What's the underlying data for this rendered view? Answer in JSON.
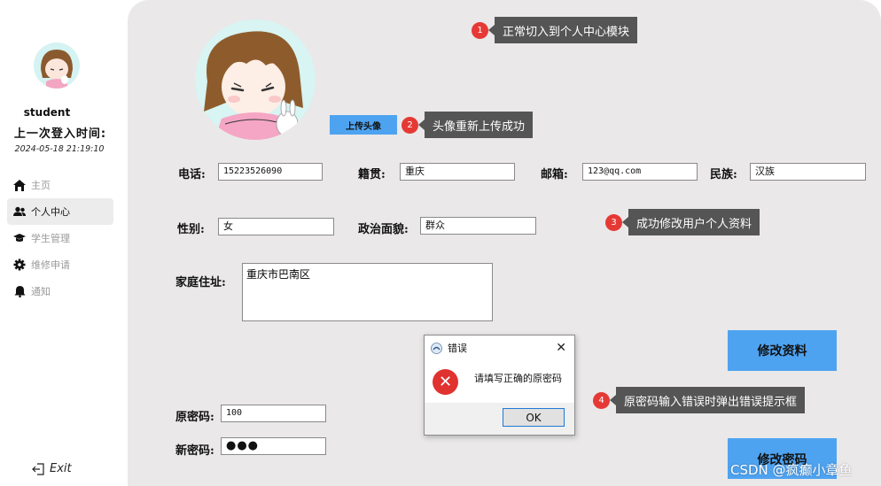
{
  "sidebar": {
    "username": "student",
    "last_login_label": "上一次登入时间:",
    "last_login_time": "2024-05-18 21:19:10",
    "items": [
      {
        "label": "主页",
        "icon": "home-icon"
      },
      {
        "label": "个人中心",
        "icon": "users-icon"
      },
      {
        "label": "学生管理",
        "icon": "graduation-cap-icon"
      },
      {
        "label": "维修申请",
        "icon": "gear-icon"
      },
      {
        "label": "通知",
        "icon": "bell-icon"
      }
    ],
    "active_item": "个人中心",
    "exit_label": "Exit"
  },
  "profile": {
    "upload_label": "上传头像",
    "fields": {
      "phone": {
        "label": "电话:",
        "value": "15223526090"
      },
      "native_place": {
        "label": "籍贯:",
        "value": "重庆"
      },
      "email": {
        "label": "邮箱:",
        "value": "123@qq.com"
      },
      "ethnicity": {
        "label": "民族:",
        "value": "汉族"
      },
      "gender": {
        "label": "性别:",
        "value": "女"
      },
      "political": {
        "label": "政治面貌:",
        "value": "群众"
      },
      "address": {
        "label": "家庭住址:",
        "value": "重庆市巴南区"
      },
      "old_password": {
        "label": "原密码:",
        "value": "100"
      },
      "new_password": {
        "label": "新密码:",
        "value": "●●●"
      }
    },
    "modify_info_label": "修改资料",
    "modify_password_label": "修改密码"
  },
  "callouts": [
    {
      "num": "1",
      "text": "正常切入到个人中心模块"
    },
    {
      "num": "2",
      "text": "头像重新上传成功"
    },
    {
      "num": "3",
      "text": "成功修改用户个人资料"
    },
    {
      "num": "4",
      "text": "原密码输入错误时弹出错误提示框"
    }
  ],
  "dialog": {
    "title": "错误",
    "message": "请填写正确的原密码",
    "ok_label": "OK"
  },
  "watermark": "CSDN @疯癫小章鱼",
  "colors": {
    "accent_blue": "#4ea3f1",
    "panel_bg": "#eae8e9",
    "callout_bg": "#555555",
    "callout_badge": "#e53935"
  }
}
